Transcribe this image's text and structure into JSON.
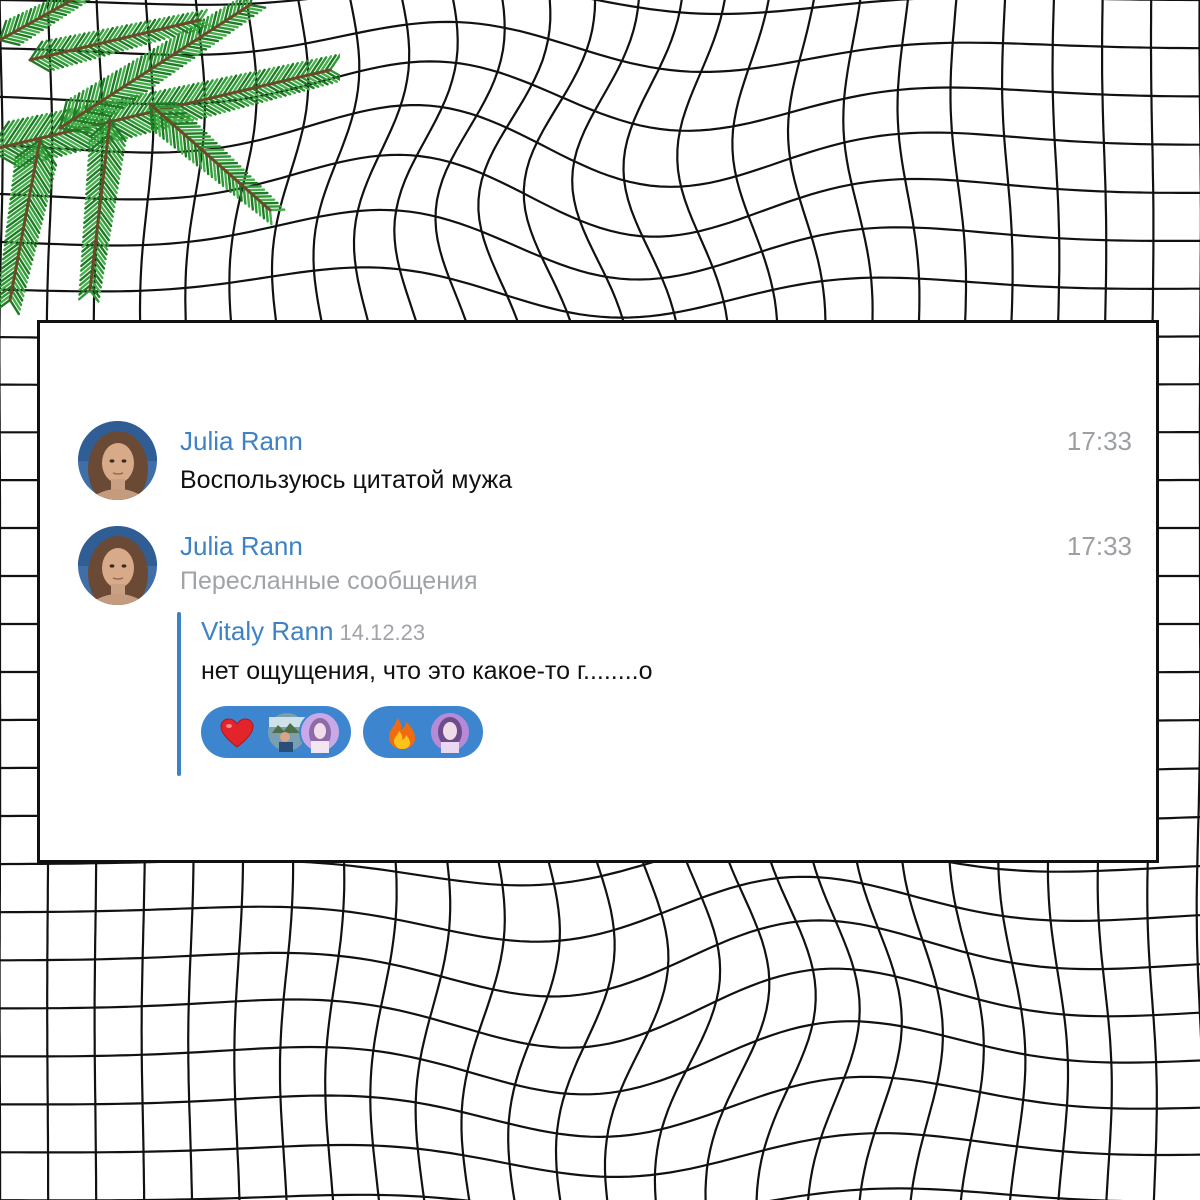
{
  "colors": {
    "accent": "#3d82c4",
    "reaction_bg": "#3d86cf",
    "muted": "#9b9ea3",
    "text": "#111111"
  },
  "messages": [
    {
      "author": "Julia Rann",
      "time": "17:33",
      "text": "Воспользуюсь цитатой мужа"
    },
    {
      "author": "Julia Rann",
      "time": "17:33",
      "subtitle": "Пересланные сообщения",
      "forwarded": {
        "author": "Vitaly Rann",
        "date": "14.12.23",
        "text": "нет ощущения, что это какое-то г........о",
        "reactions": [
          {
            "emoji": "heart-emoji",
            "reactor_avatars": 2
          },
          {
            "emoji": "fire-emoji",
            "reactor_avatars": 1
          }
        ]
      }
    }
  ]
}
